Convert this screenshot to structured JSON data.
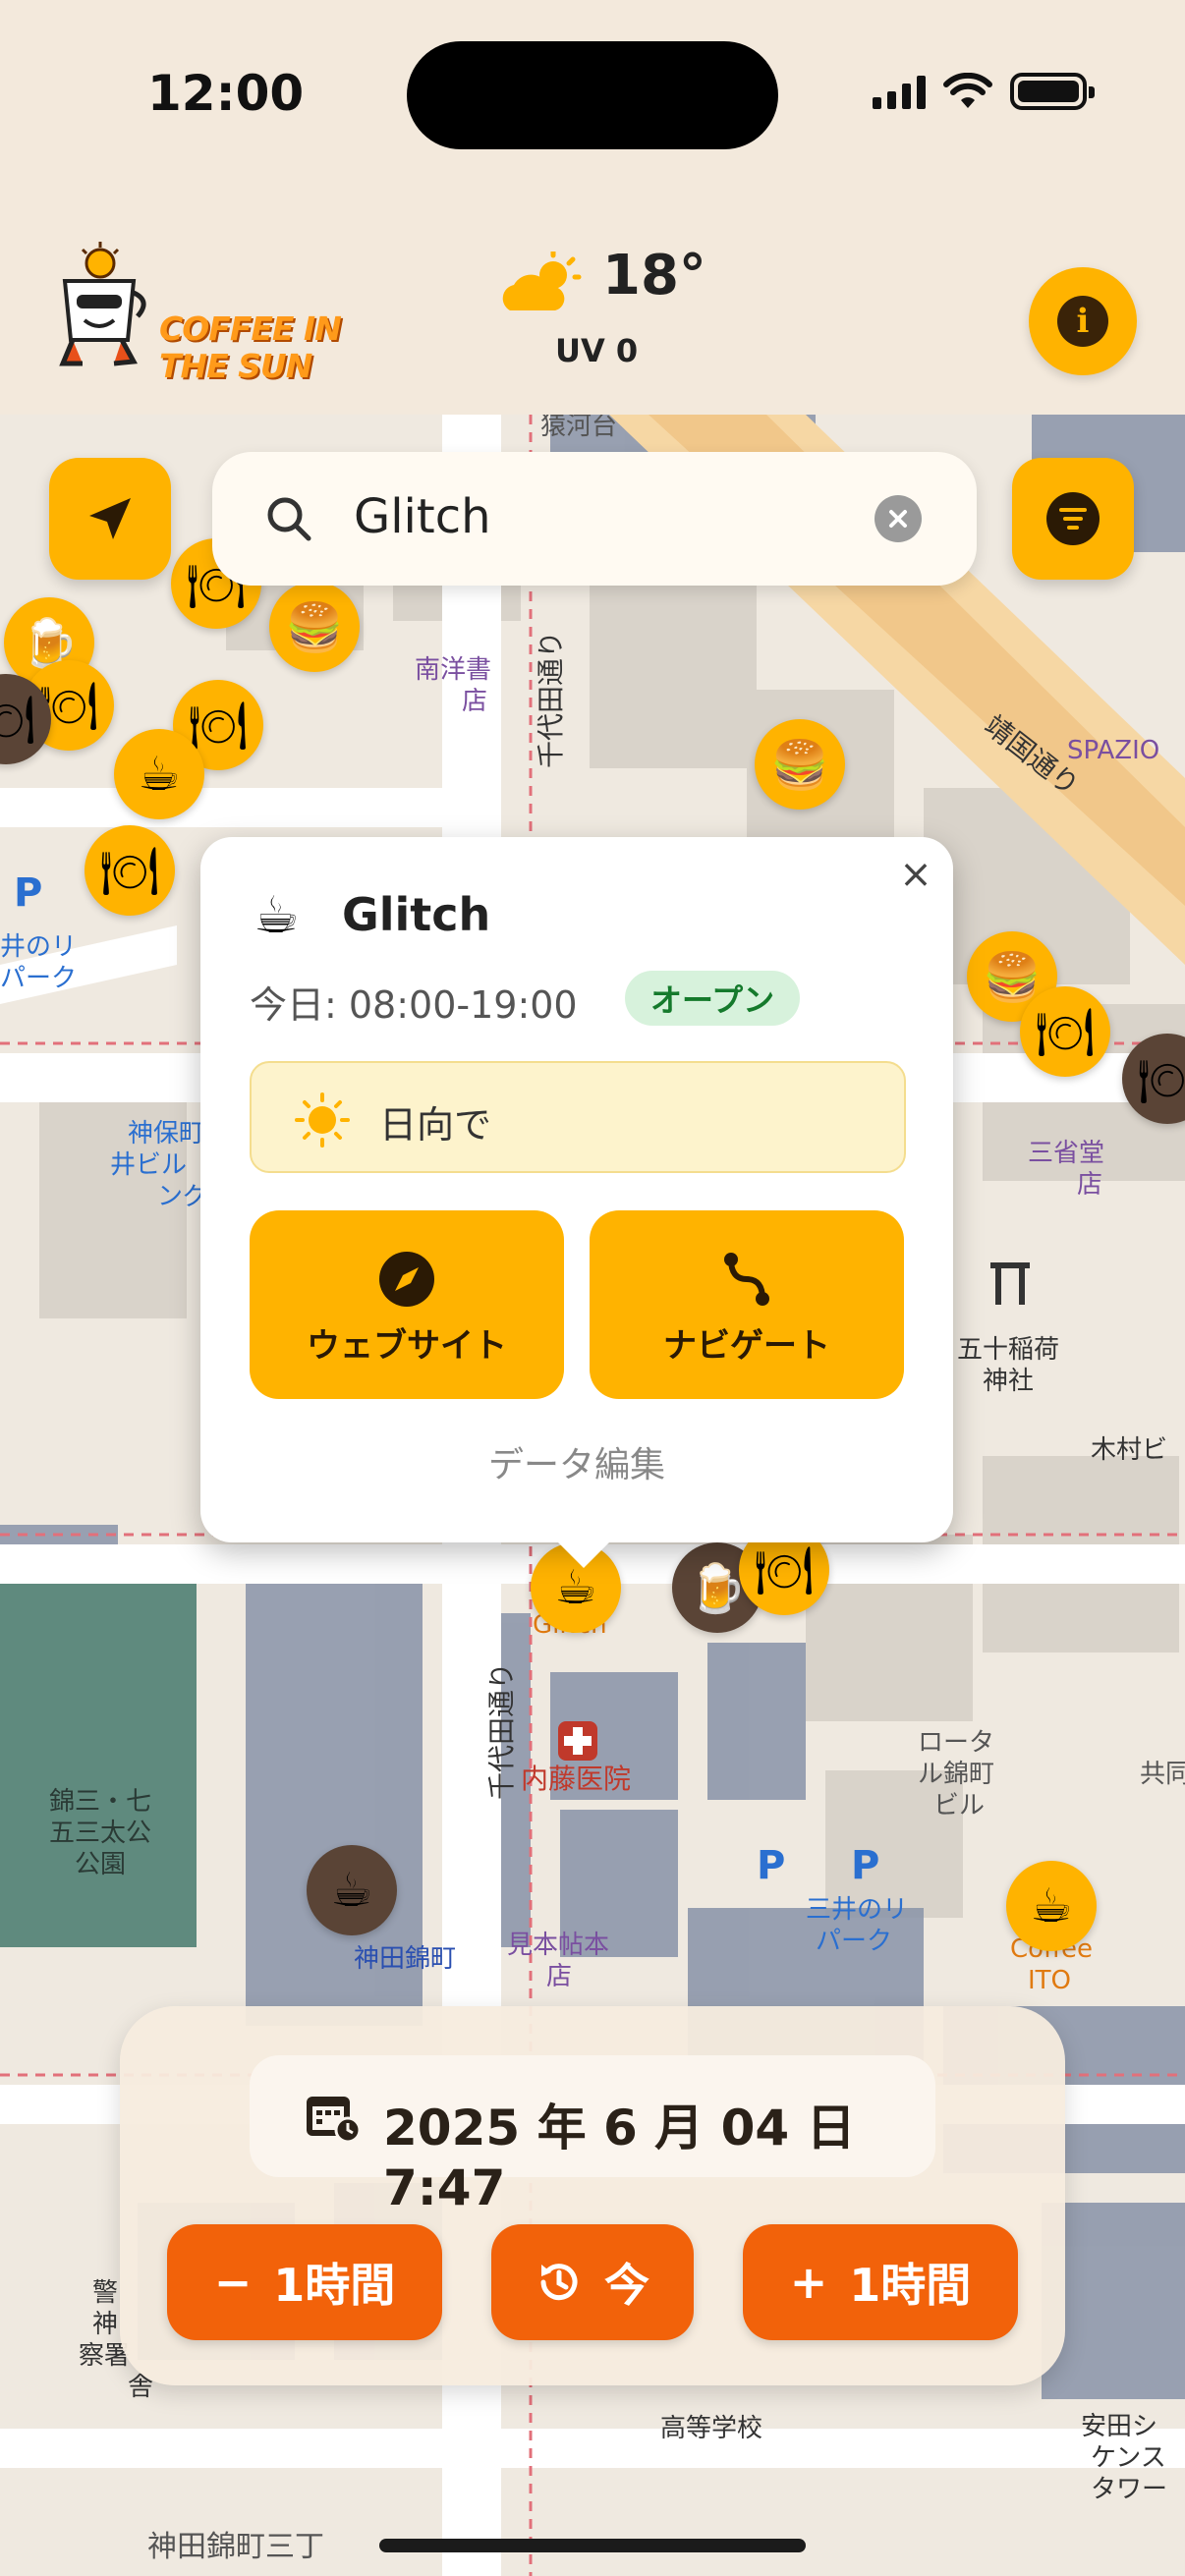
{
  "status": {
    "time": "12:00"
  },
  "header": {
    "logo_line1": "COFFEE IN",
    "logo_line2": "THE SUN",
    "temperature": "18°",
    "uv": "UV 0"
  },
  "search": {
    "value": "Glitch"
  },
  "popup": {
    "icon": "coffee-cup-icon",
    "name": "Glitch",
    "hours": "今日: 08:00-19:00",
    "status_badge": "オープン",
    "sun_status": "日向で",
    "website_label": "ウェブサイト",
    "navigate_label": "ナビゲート",
    "edit_label": "データ編集"
  },
  "time_panel": {
    "date": "2025 年 6 月 04 日 7:47",
    "minus_label": "1時間",
    "now_label": "今",
    "plus_label": "1時間"
  },
  "map_labels": {
    "street1": "千代田通り",
    "street2": "靖国通り",
    "street3": "千代田通り",
    "spazio": "SPAZIO",
    "hospital": "内藤医院",
    "park1": "錦三・七\n五三太公\n公園",
    "shrine": "五十稲荷\n神社",
    "kanda": "神田錦町",
    "parking1": "三井のリ\nパーク",
    "mitsui": "井のリ\nパーク",
    "jinbo": "神保町\n井ビル\nング",
    "ito": "Coffee\nITO",
    "glitch": "Glitch",
    "minami": "南洋書\n店",
    "kimura": "木村ビ",
    "nanjo": "見本帖本\n店",
    "school": "高等学校",
    "kandasanchome": "神田錦町三丁",
    "yasuda": "安田シ\nケンス\nタワー",
    "sansei": "三省堂\n店",
    "keisatsu": "警\n神\n察署\n舎",
    "bldg": "ロータ\nル錦町\nビル",
    "sarugaku": "猿河台",
    "kyou": "共同"
  },
  "colors": {
    "accent": "#ffb300",
    "action": "#f2620a",
    "open_badge": "#d7f2dc"
  }
}
